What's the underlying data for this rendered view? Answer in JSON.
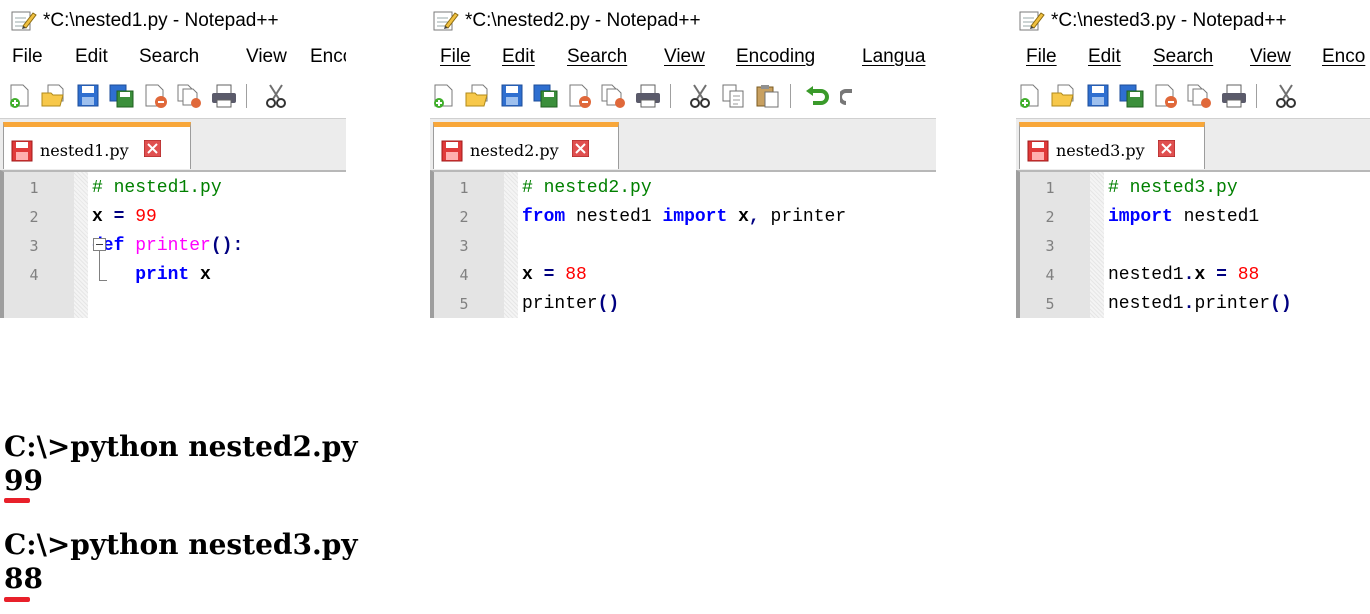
{
  "windows": [
    {
      "title": "*C:\\nested1.py - Notepad++",
      "menu": {
        "file": "File",
        "edit": "Edit",
        "search": "Search",
        "view": "View",
        "encoding": "Enco"
      },
      "tab_label": "nested1.py",
      "lines": {
        "l1": {
          "n": "1",
          "comment": "# nested1.py"
        },
        "l2": {
          "n": "2",
          "a": "x",
          "op": "=",
          "num": "99"
        },
        "l3": {
          "n": "3",
          "kw": "def",
          "fn": "printer",
          "paren": "():"
        },
        "l4": {
          "n": "4",
          "indent": "    ",
          "kw": "print",
          "rest": "x"
        }
      }
    },
    {
      "title": "*C:\\nested2.py - Notepad++",
      "menu": {
        "file": "File",
        "edit": "Edit",
        "search": "Search",
        "view": "View",
        "encoding": "Encoding",
        "language": "Langua"
      },
      "tab_label": "nested2.py",
      "lines": {
        "l1": {
          "n": "1",
          "comment": "# nested2.py"
        },
        "l2": {
          "n": "2",
          "kw1": "from",
          "mod": "nested1",
          "kw2": "import",
          "rest1": "x",
          "comma": ",",
          "rest2": "printer"
        },
        "l3": {
          "n": "3"
        },
        "l4": {
          "n": "4",
          "a": "x",
          "op": "=",
          "num": "88"
        },
        "l5": {
          "n": "5",
          "call": "printer",
          "paren": "()"
        }
      }
    },
    {
      "title": "*C:\\nested3.py - Notepad++",
      "menu": {
        "file": "File",
        "edit": "Edit",
        "search": "Search",
        "view": "View",
        "encoding": "Enco"
      },
      "tab_label": "nested3.py",
      "lines": {
        "l1": {
          "n": "1",
          "comment": "# nested3.py"
        },
        "l2": {
          "n": "2",
          "kw": "import",
          "mod": "nested1"
        },
        "l3": {
          "n": "3"
        },
        "l4": {
          "n": "4",
          "a": "nested1",
          "dot": ".",
          "b": "x",
          "op": "=",
          "num": "88"
        },
        "l5": {
          "n": "5",
          "a": "nested1",
          "dot": ".",
          "call": "printer",
          "paren": "()"
        }
      }
    }
  ],
  "console": {
    "cmd1": "C:\\>python nested2.py",
    "out1": "99",
    "cmd2": "C:\\>python nested3.py",
    "out2": "88"
  }
}
